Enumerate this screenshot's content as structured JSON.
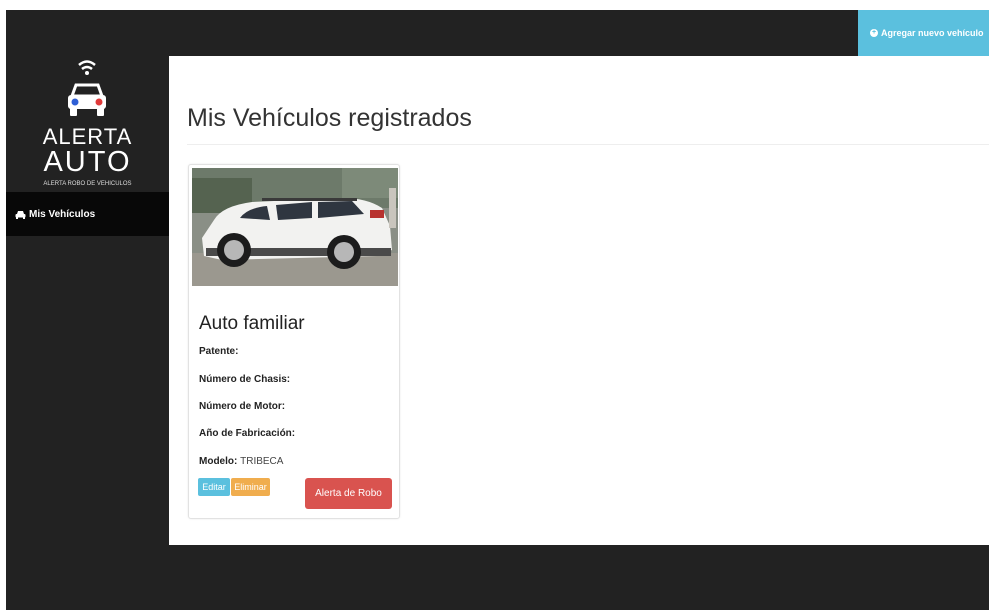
{
  "header": {
    "add_vehicle_label": "Agregar nuevo vehículo",
    "add_icon": "plus-circle-icon"
  },
  "sidebar": {
    "logo": {
      "line1": "ALERTA",
      "line2": "AUTO",
      "tagline": "ALERTA ROBO DE VEHICULOS"
    },
    "items": [
      {
        "label": "Mis Vehículos",
        "icon": "car-icon",
        "active": true
      }
    ]
  },
  "main": {
    "title": "Mis Vehículos registrados",
    "vehicles": [
      {
        "name": "Auto familiar",
        "fields": [
          {
            "label": "Patente:",
            "value": ""
          },
          {
            "label": "Número de Chasis:",
            "value": ""
          },
          {
            "label": "Número de Motor:",
            "value": ""
          },
          {
            "label": "Año de Fabricación:",
            "value": ""
          },
          {
            "label": "Modelo:",
            "value": "TRIBECA"
          }
        ],
        "buttons": {
          "edit": "Editar",
          "delete": "Eliminar",
          "alert": "Alerta de Robo"
        }
      }
    ]
  },
  "colors": {
    "dark": "#222222",
    "info": "#5bc0de",
    "warning": "#f0ad4e",
    "danger": "#d9534f"
  }
}
